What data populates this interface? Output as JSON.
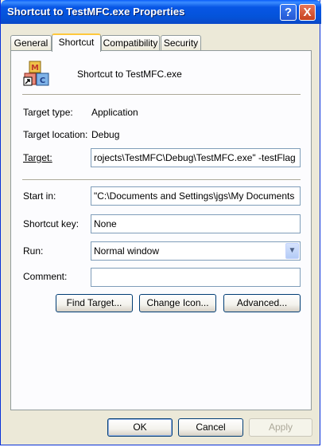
{
  "window": {
    "title": "Shortcut to TestMFC.exe Properties",
    "help_glyph": "?",
    "close_glyph": "X"
  },
  "tabs": [
    {
      "label": "General",
      "active": false
    },
    {
      "label": "Shortcut",
      "active": true
    },
    {
      "label": "Compatibility",
      "active": false
    },
    {
      "label": "Security",
      "active": false
    }
  ],
  "shortcut": {
    "icon": "mfc-application-icon",
    "file_name": "Shortcut to TestMFC.exe",
    "target_type_label": "Target type:",
    "target_type_value": "Application",
    "target_location_label": "Target location:",
    "target_location_value": "Debug",
    "target_label": "Target:",
    "target_value": "rojects\\TestMFC\\Debug\\TestMFC.exe\" -testFlag",
    "start_in_label": "Start in:",
    "start_in_value": "\"C:\\Documents and Settings\\jgs\\My Documents",
    "shortcut_key_label": "Shortcut key:",
    "shortcut_key_value": "None",
    "run_label": "Run:",
    "run_value": "Normal window",
    "comment_label": "Comment:",
    "comment_value": "",
    "find_target_label": "Find Target...",
    "change_icon_label": "Change Icon...",
    "advanced_label": "Advanced..."
  },
  "footer": {
    "ok_label": "OK",
    "cancel_label": "Cancel",
    "apply_label": "Apply"
  },
  "colors": {
    "titlebar": "#0453d9",
    "active_tab_accent": "#ffc83c",
    "dialog_bg": "#ece9d8",
    "field_border": "#7f9db9"
  }
}
